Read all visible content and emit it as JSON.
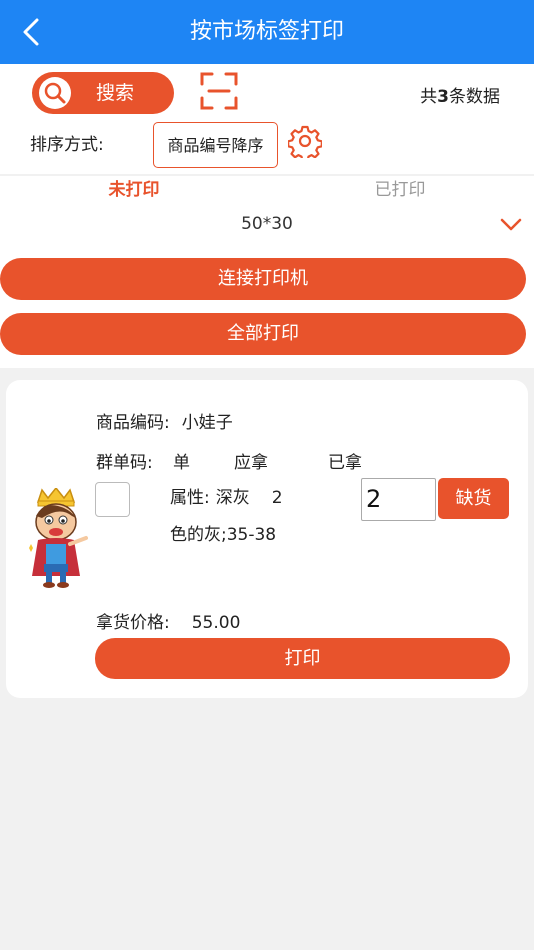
{
  "header": {
    "title": "按市场标签打印"
  },
  "toolbar": {
    "search_label": "搜索",
    "count_prefix": "共",
    "count_value": "3",
    "count_suffix": "条数据",
    "sort_label": "排序方式:",
    "sort_value": "商品编号降序"
  },
  "tabs": [
    {
      "label": "未打印",
      "active": true
    },
    {
      "label": "已打印",
      "active": false
    }
  ],
  "label_size": "50*30",
  "buttons": {
    "connect_printer": "连接打印机",
    "print_all": "全部打印"
  },
  "item": {
    "code_label": "商品编码:",
    "code_value": "小娃子",
    "group_label": "群单码:",
    "group_value": "单",
    "should_take": "应拿",
    "taken": "已拿",
    "attr_label": "属性:",
    "attr_value": "深灰",
    "attr_count": "2",
    "attr_detail": "色的灰;35-38",
    "quantity": "2",
    "out_of_stock": "缺货",
    "price_label": "拿货价格:",
    "price_value": "55.00",
    "print": "打印"
  },
  "colors": {
    "header": "#1e85f4",
    "accent": "#e8532c"
  }
}
